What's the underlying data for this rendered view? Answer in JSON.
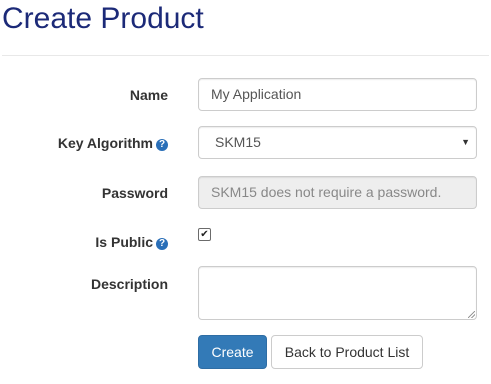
{
  "page": {
    "title": "Create Product"
  },
  "form": {
    "name": {
      "label": "Name",
      "value": "My Application"
    },
    "key_algorithm": {
      "label": "Key Algorithm",
      "selected": "SKM15",
      "help_icon": "question-circle-icon"
    },
    "password": {
      "label": "Password",
      "placeholder": "SKM15 does not require a password."
    },
    "is_public": {
      "label": "Is Public",
      "checked": true,
      "check_glyph": "✔",
      "help_icon": "question-circle-icon"
    },
    "description": {
      "label": "Description",
      "value": ""
    }
  },
  "actions": {
    "create_label": "Create",
    "back_label": "Back to Product List"
  },
  "colors": {
    "title": "#1c2a78",
    "primary": "#337ab7",
    "help_icon": "#2a6fb8"
  }
}
